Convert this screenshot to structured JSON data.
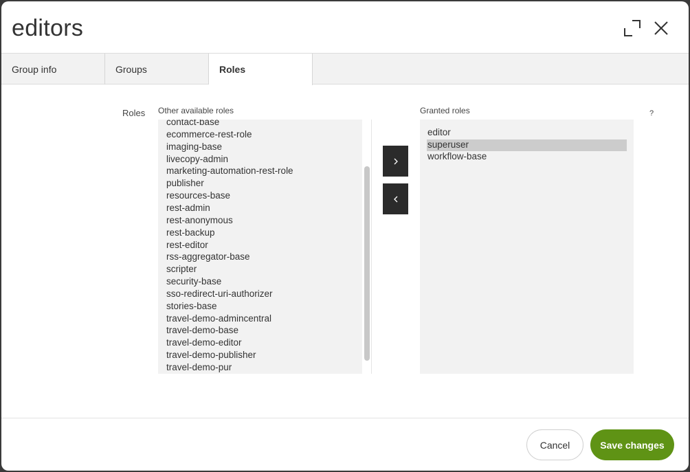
{
  "dialog": {
    "title": "editors"
  },
  "tabs": [
    {
      "label": "Group info",
      "active": false
    },
    {
      "label": "Groups",
      "active": false
    },
    {
      "label": "Roles",
      "active": true
    }
  ],
  "roles_field": {
    "label": "Roles",
    "help": "?",
    "available_label": "Other available roles",
    "granted_label": "Granted roles",
    "available_roles": [
      "contact-base",
      "ecommerce-rest-role",
      "imaging-base",
      "livecopy-admin",
      "marketing-automation-rest-role",
      "publisher",
      "resources-base",
      "rest-admin",
      "rest-anonymous",
      "rest-backup",
      "rest-editor",
      "rss-aggregator-base",
      "scripter",
      "security-base",
      "sso-redirect-uri-authorizer",
      "stories-base",
      "travel-demo-admincentral",
      "travel-demo-base",
      "travel-demo-editor",
      "travel-demo-publisher",
      "travel-demo-pur"
    ],
    "granted_roles": [
      "editor",
      "superuser",
      "workflow-base"
    ],
    "selected_granted": "superuser"
  },
  "buttons": {
    "cancel": "Cancel",
    "save": "Save changes"
  },
  "icons": {
    "expand": "expand-icon",
    "close": "close-icon",
    "add": "chevron-right-icon",
    "remove": "chevron-left-icon"
  },
  "colors": {
    "primary": "#5f9315",
    "move_button": "#2b2b2b",
    "selection": "#cccccc"
  }
}
